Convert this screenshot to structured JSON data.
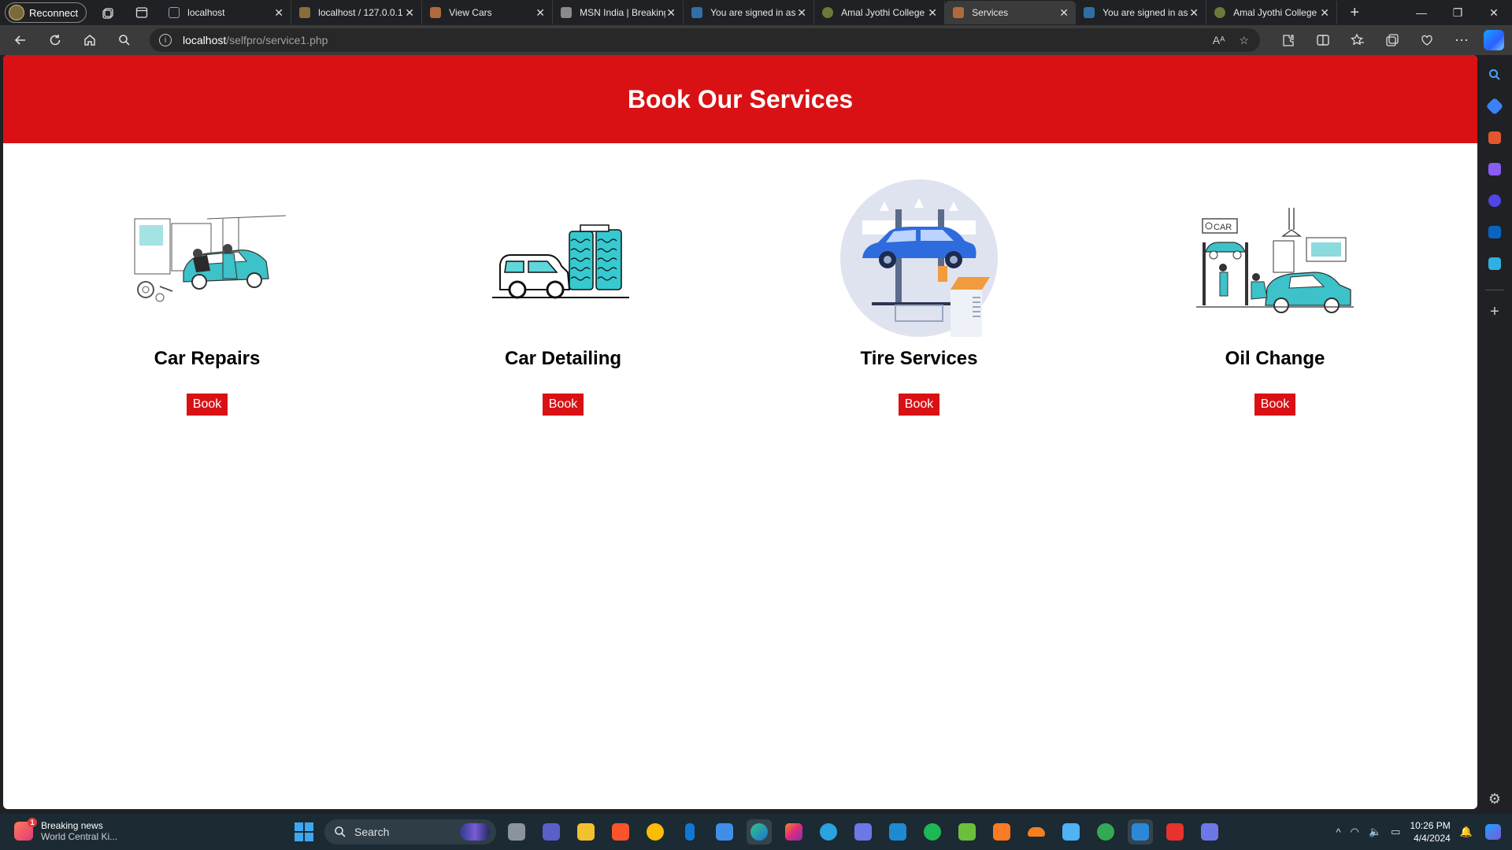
{
  "browser": {
    "reconnect_label": "Reconnect",
    "tabs": [
      {
        "title": "localhost",
        "favicon_color": "#5f6368"
      },
      {
        "title": "localhost / 127.0.0.1",
        "favicon_color": "#8a6d3b"
      },
      {
        "title": "View Cars",
        "favicon_color": "#b06a3a"
      },
      {
        "title": "MSN India | Breaking",
        "favicon_color": "#8a8a8a"
      },
      {
        "title": "You are signed in as",
        "favicon_color": "#2f6fa8"
      },
      {
        "title": "Amal Jyothi College",
        "favicon_color": "#6b7a3a"
      },
      {
        "title": "Services",
        "favicon_color": "#b06a3a",
        "active": true
      },
      {
        "title": "You are signed in as",
        "favicon_color": "#2f6fa8"
      },
      {
        "title": "Amal Jyothi College",
        "favicon_color": "#6b7a3a"
      }
    ],
    "url_host": "localhost",
    "url_path": "/selfpro/service1.php"
  },
  "page": {
    "heading": "Book Our Services",
    "accent_color": "#d91114",
    "services": [
      {
        "name": "Car Repairs",
        "button": "Book",
        "illustration": "mechanic-repairing-car"
      },
      {
        "name": "Car Detailing",
        "button": "Book",
        "illustration": "car-wash"
      },
      {
        "name": "Tire Services",
        "button": "Book",
        "illustration": "car-on-lift"
      },
      {
        "name": "Oil Change",
        "button": "Book",
        "illustration": "garage-oil-change"
      }
    ]
  },
  "taskbar": {
    "news_title": "Breaking news",
    "news_subtitle": "World Central Ki...",
    "news_badge": "1",
    "search_label": "Search",
    "time": "10:26 PM",
    "date": "4/4/2024"
  }
}
